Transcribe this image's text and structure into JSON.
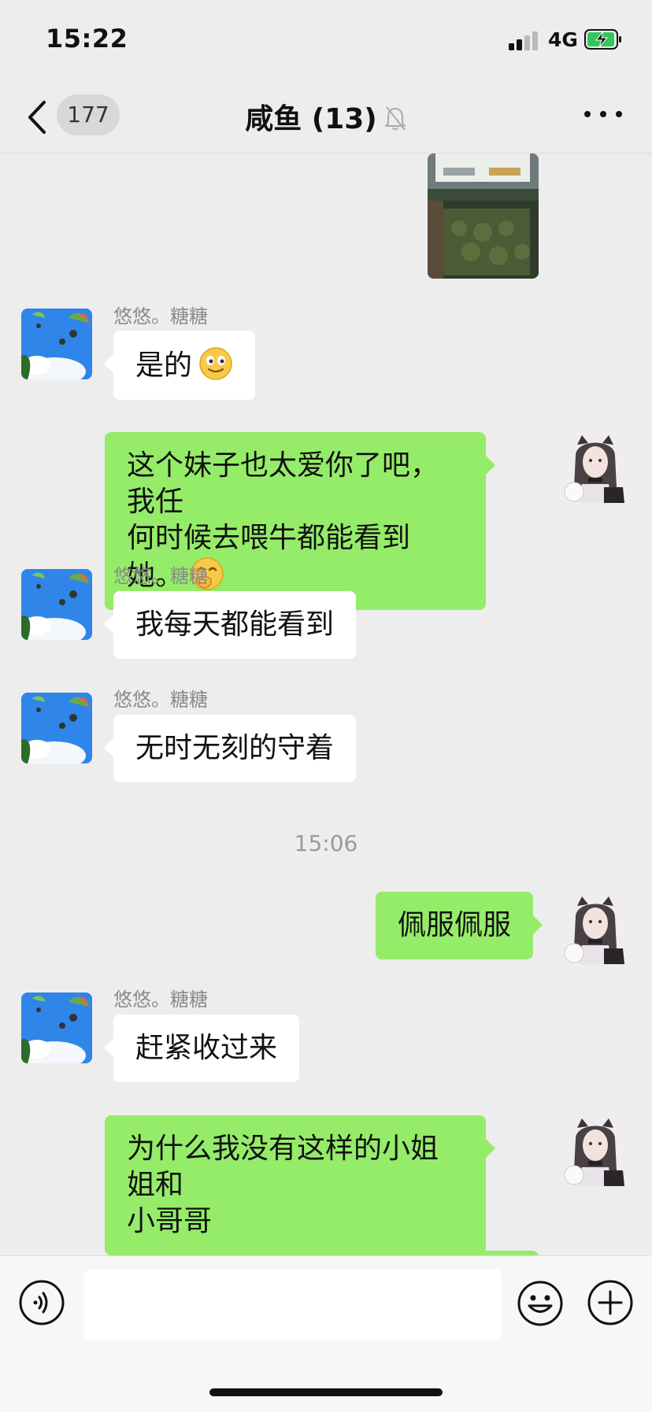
{
  "status_bar": {
    "time": "15:22",
    "network": "4G"
  },
  "header": {
    "unread_count": "177",
    "title": "咸鱼 (13)"
  },
  "chat": {
    "messages": [
      {
        "sender": "悠悠。糖糖",
        "text": "是的"
      },
      {
        "text_line1": "这个妹子也太爱你了吧，我任",
        "text_line2": "何时候去喂牛都能看到她。"
      },
      {
        "sender": "悠悠。糖糖",
        "text": "我每天都能看到"
      },
      {
        "sender": "悠悠。糖糖",
        "text": "无时无刻的守着"
      },
      {
        "timestamp": "15:06"
      },
      {
        "text": "佩服佩服"
      },
      {
        "sender": "悠悠。糖糖",
        "text": "赶紧收过来"
      },
      {
        "text_line1": "为什么我没有这样的小姐姐和",
        "text_line2": "小哥哥"
      }
    ]
  },
  "input_bar": {
    "placeholder": ""
  },
  "colors": {
    "background": "#ededed",
    "outgoing_bubble": "#95ec69",
    "incoming_bubble": "#ffffff"
  }
}
